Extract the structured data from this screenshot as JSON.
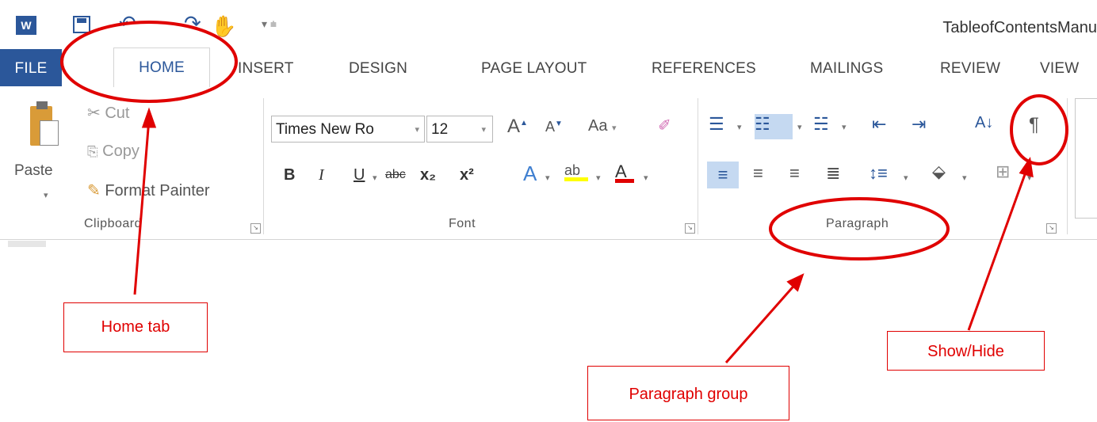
{
  "title_bar": {
    "document_title": "TableofContentsManu",
    "word_icon": "word-app-icon",
    "save_icon": "save-icon",
    "undo_icon": "undo-icon",
    "redo_icon": "redo-icon",
    "touch_icon": "touch-mode-icon",
    "customize_icon": "customize-qat-icon"
  },
  "tabs": {
    "file": "FILE",
    "home": "HOME",
    "insert": "INSERT",
    "design": "DESIGN",
    "page_layout": "PAGE LAYOUT",
    "references": "REFERENCES",
    "mailings": "MAILINGS",
    "review": "REVIEW",
    "view": "VIEW"
  },
  "clipboard": {
    "label": "Clipboard",
    "paste": "Paste",
    "cut": "Cut",
    "copy": "Copy",
    "format_painter": "Format Painter"
  },
  "font": {
    "label": "Font",
    "font_name": "Times New Ro",
    "font_size": "12",
    "bold": "B",
    "italic": "I",
    "underline": "U",
    "strikethrough": "abc",
    "subscript": "x₂",
    "superscript": "x²",
    "change_case": "Aa"
  },
  "paragraph": {
    "label": "Paragraph",
    "show_hide": "¶"
  },
  "annotations": {
    "home_tab": "Home tab",
    "paragraph_group": "Paragraph group",
    "show_hide": "Show/Hide",
    "color": "#e00000"
  },
  "colors": {
    "word_blue": "#2b579a",
    "highlight": "#c5d9f1"
  }
}
